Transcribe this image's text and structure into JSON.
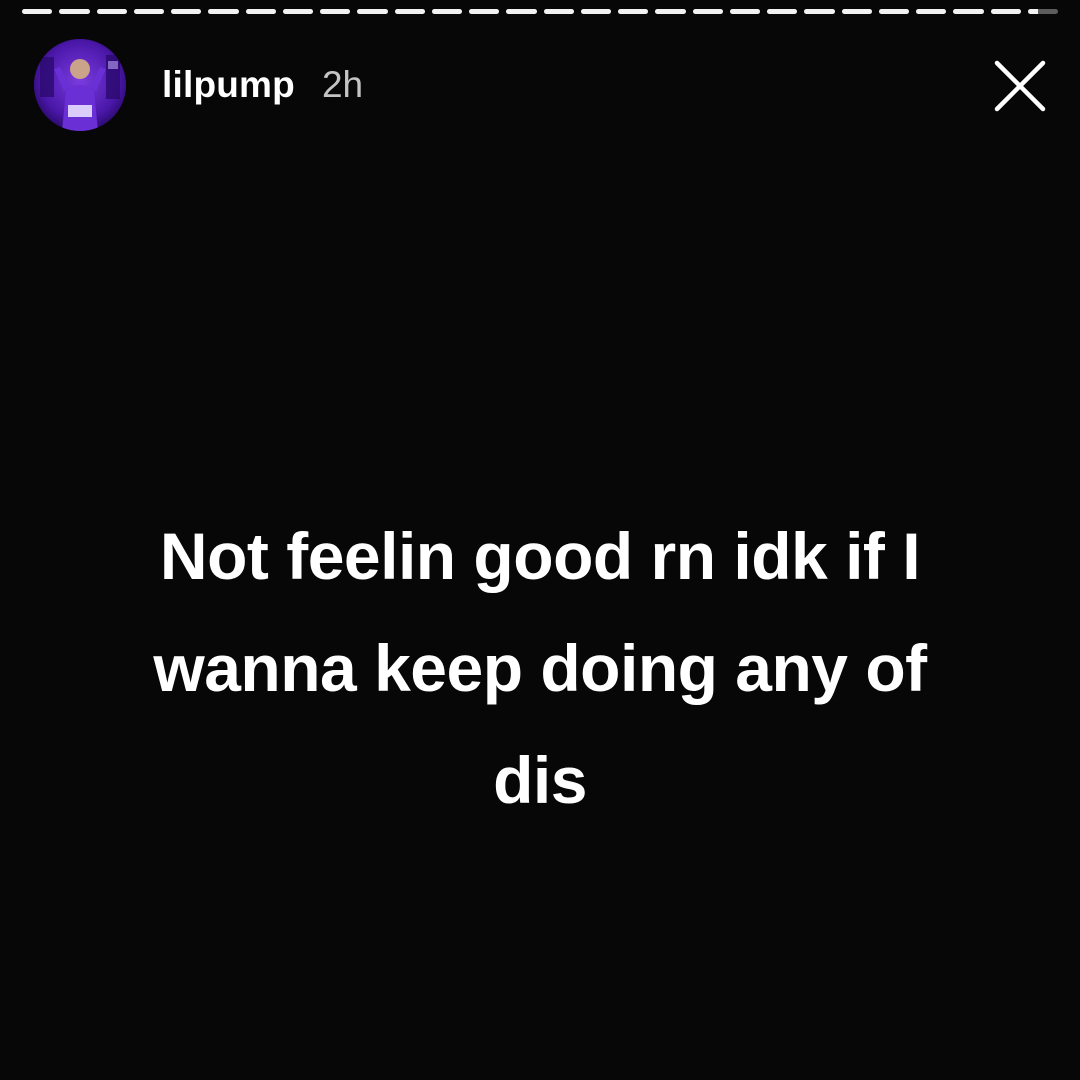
{
  "story": {
    "segments": [
      1,
      1,
      1,
      1,
      1,
      1,
      1,
      1,
      1,
      1,
      1,
      1,
      1,
      1,
      1,
      1,
      1,
      1,
      1,
      1,
      1,
      1,
      1,
      1,
      1,
      1,
      1,
      0.35
    ],
    "colors": {
      "background": "#070707",
      "progress_fill": "#ffffff",
      "avatar_accent": "#6a2bd1"
    }
  },
  "header": {
    "username": "lilpump",
    "timestamp": "2h",
    "avatar_icon": "profile-avatar",
    "close_icon": "close-x"
  },
  "caption": {
    "lines": [
      "Not feelin good rn idk if I",
      "wanna keep doing any of",
      "dis"
    ]
  }
}
